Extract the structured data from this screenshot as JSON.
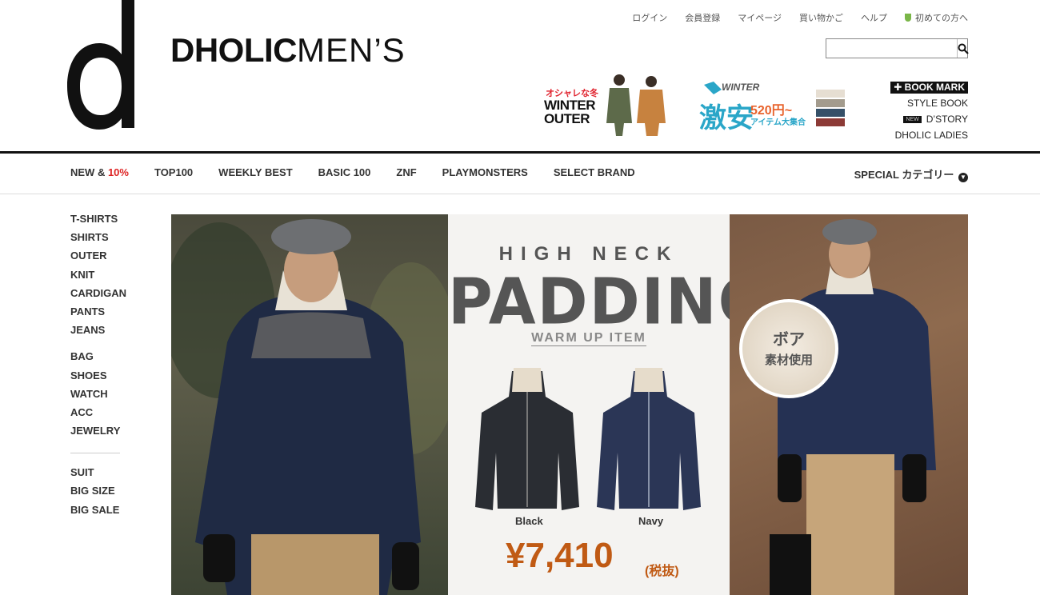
{
  "brand": {
    "name_bold": "DHOLIC",
    "name_light": "MEN’S"
  },
  "util_nav": [
    "ログイン",
    "会員登録",
    "マイページ",
    "買い物かご",
    "ヘルプ",
    "初めての方へ"
  ],
  "search": {
    "value": "",
    "placeholder": ""
  },
  "promos": {
    "outer": {
      "sub": "オシャレな冬",
      "title1": "WINTER",
      "title2": "OUTER"
    },
    "winter_sale": {
      "tag": "WINTER",
      "big": "激安",
      "price": "520円~",
      "caption": "アイテム大集合"
    }
  },
  "side_links": {
    "bookmark": "BOOK MARK",
    "style_book": "STYLE BOOK",
    "new_tag": "NEW",
    "dstory": "D’STORY",
    "ladies": "DHOLIC LADIES"
  },
  "catnav": {
    "new_a": "NEW & ",
    "new_b": "10%",
    "items": [
      "TOP100",
      "WEEKLY BEST",
      "BASIC 100",
      "ZNF",
      "PLAYMONSTERS",
      "SELECT BRAND"
    ],
    "special": "SPECIAL カテゴリー"
  },
  "sidebar": {
    "group1": [
      "T-SHIRTS",
      "SHIRTS",
      "OUTER",
      "KNIT",
      "CARDIGAN",
      "PANTS",
      "JEANS"
    ],
    "group2": [
      "BAG",
      "SHOES",
      "WATCH",
      "ACC",
      "JEWELRY"
    ],
    "group3": [
      "SUIT",
      "BIG SIZE",
      "BIG SALE"
    ]
  },
  "hero": {
    "kicker": "HIGH NECK",
    "title": "PADDING",
    "subtitle": "WARM UP ITEM",
    "colors": [
      "Black",
      "Navy"
    ],
    "price": "¥7,410",
    "tax": "(税抜)",
    "badge_line1": "ボア",
    "badge_line2": "素材使用"
  }
}
